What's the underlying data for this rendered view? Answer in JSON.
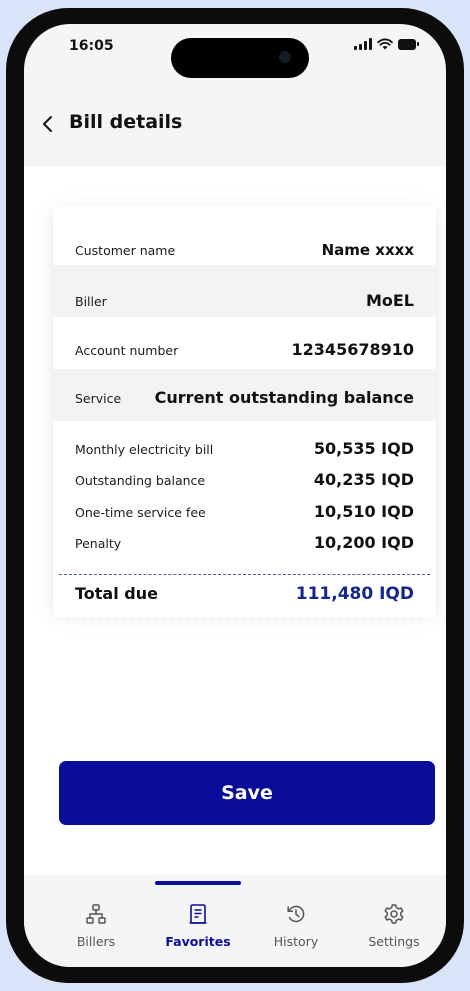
{
  "status_bar": {
    "time": "16:05"
  },
  "header": {
    "title": "Bill details"
  },
  "bill": {
    "customer_name": {
      "label": "Customer name",
      "value": "Name xxxx"
    },
    "biller": {
      "label": "Biller",
      "value": "MoEL"
    },
    "account_number": {
      "label": "Account number",
      "value": "12345678910"
    },
    "service": {
      "label": "Service",
      "value": "Current outstanding balance"
    },
    "items": [
      {
        "label": "Monthly electricity bill",
        "value": "50,535 IQD"
      },
      {
        "label": "Outstanding balance",
        "value": "40,235 IQD"
      },
      {
        "label": "One-time service fee",
        "value": "10,510 IQD"
      },
      {
        "label": "Penalty",
        "value": "10,200 IQD"
      }
    ],
    "total": {
      "label": "Total due",
      "value": "111,480 IQD"
    }
  },
  "actions": {
    "save_label": "Save"
  },
  "tabs": [
    {
      "label": "Billers",
      "icon": "sitemap-icon"
    },
    {
      "label": "Favorites",
      "icon": "receipt-icon",
      "active": true
    },
    {
      "label": "History",
      "icon": "history-icon"
    },
    {
      "label": "Settings",
      "icon": "gear-icon"
    }
  ],
  "colors": {
    "primary": "#0a0d9a",
    "total": "#14288c",
    "background": "#d9e4f8"
  }
}
